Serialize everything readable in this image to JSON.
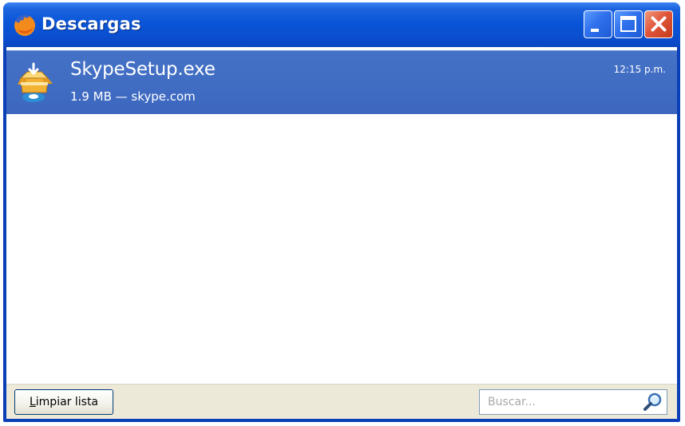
{
  "window": {
    "title": "Descargas"
  },
  "downloads": [
    {
      "name": "SkypeSetup.exe",
      "status": "1.9 MB — skype.com",
      "time": "12:15 p.m.",
      "icon": "package-icon"
    }
  ],
  "footer": {
    "clear_accel": "L",
    "clear_rest": "impiar lista",
    "search_placeholder": "Buscar..."
  },
  "colors": {
    "titlebar": "#0955d8",
    "selection": "#4472c6",
    "close_button": "#e0563a",
    "toolbar": "#ece9d8"
  }
}
